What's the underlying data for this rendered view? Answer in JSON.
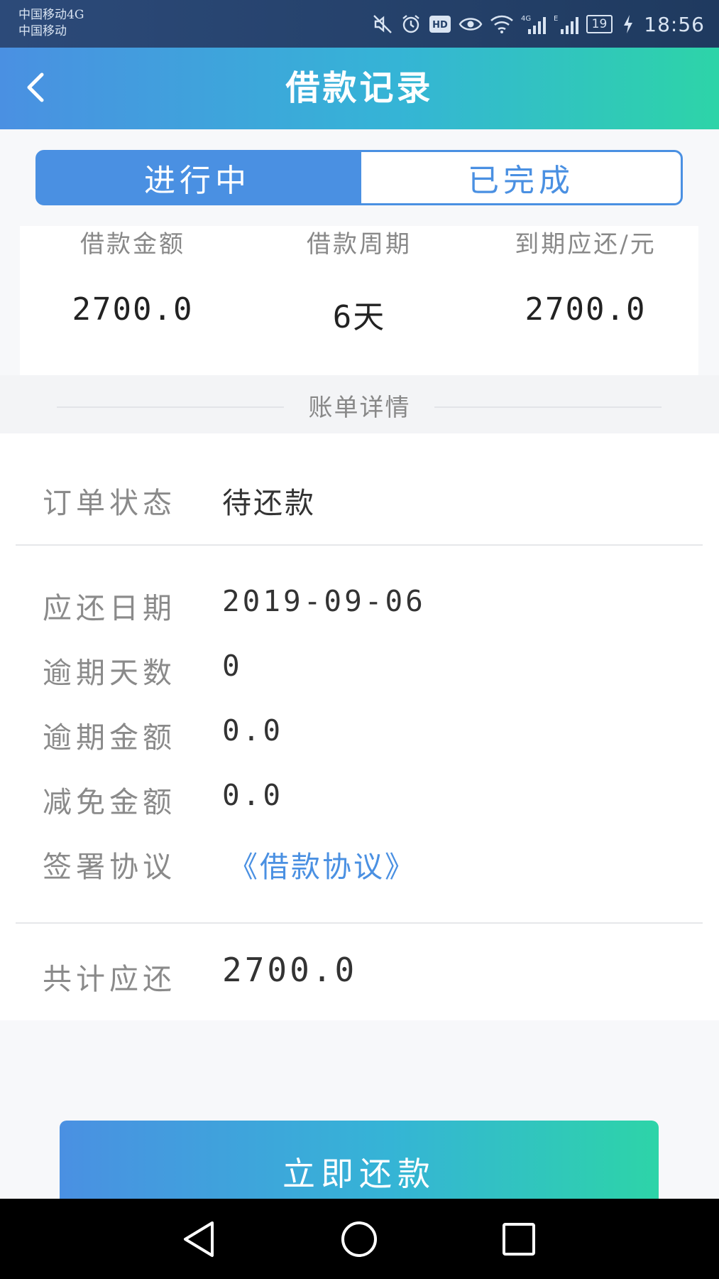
{
  "status_bar": {
    "carrier_line1": "中国移动4G",
    "carrier_line2": "中国移动",
    "battery": "19",
    "time": "18:56",
    "icons": [
      "mute-icon",
      "alarm-icon",
      "hd-icon",
      "eye-icon",
      "wifi-icon",
      "signal-4g-icon",
      "signal-e-icon",
      "battery-icon",
      "charging-icon"
    ]
  },
  "header": {
    "title": "借款记录",
    "back_icon": "chevron-left-icon"
  },
  "tabs": [
    {
      "label": "进行中",
      "active": true
    },
    {
      "label": "已完成",
      "active": false
    }
  ],
  "summary": {
    "amount_label": "借款金额",
    "amount_value": "2700.0",
    "period_label": "借款周期",
    "period_value": "6天",
    "due_label": "到期应还/元",
    "due_value": "2700.0"
  },
  "section": {
    "title": "账单详情"
  },
  "details": {
    "status_label": "订单状态",
    "status_value": "待还款",
    "due_date_label": "应还日期",
    "due_date_value": "2019-09-06",
    "overdue_days_label": "逾期天数",
    "overdue_days_value": "0",
    "overdue_amount_label": "逾期金额",
    "overdue_amount_value": "0.0",
    "waived_amount_label": "减免金额",
    "waived_amount_value": "0.0",
    "agreement_label": "签署协议",
    "agreement_link": "《借款协议》",
    "total_label": "共计应还",
    "total_value": "2700.0"
  },
  "actions": {
    "repay_label": "立即还款"
  },
  "colors": {
    "accent": "#4a90e2",
    "gradient_end": "#2dd4a8",
    "status_bar": "#23406a"
  }
}
